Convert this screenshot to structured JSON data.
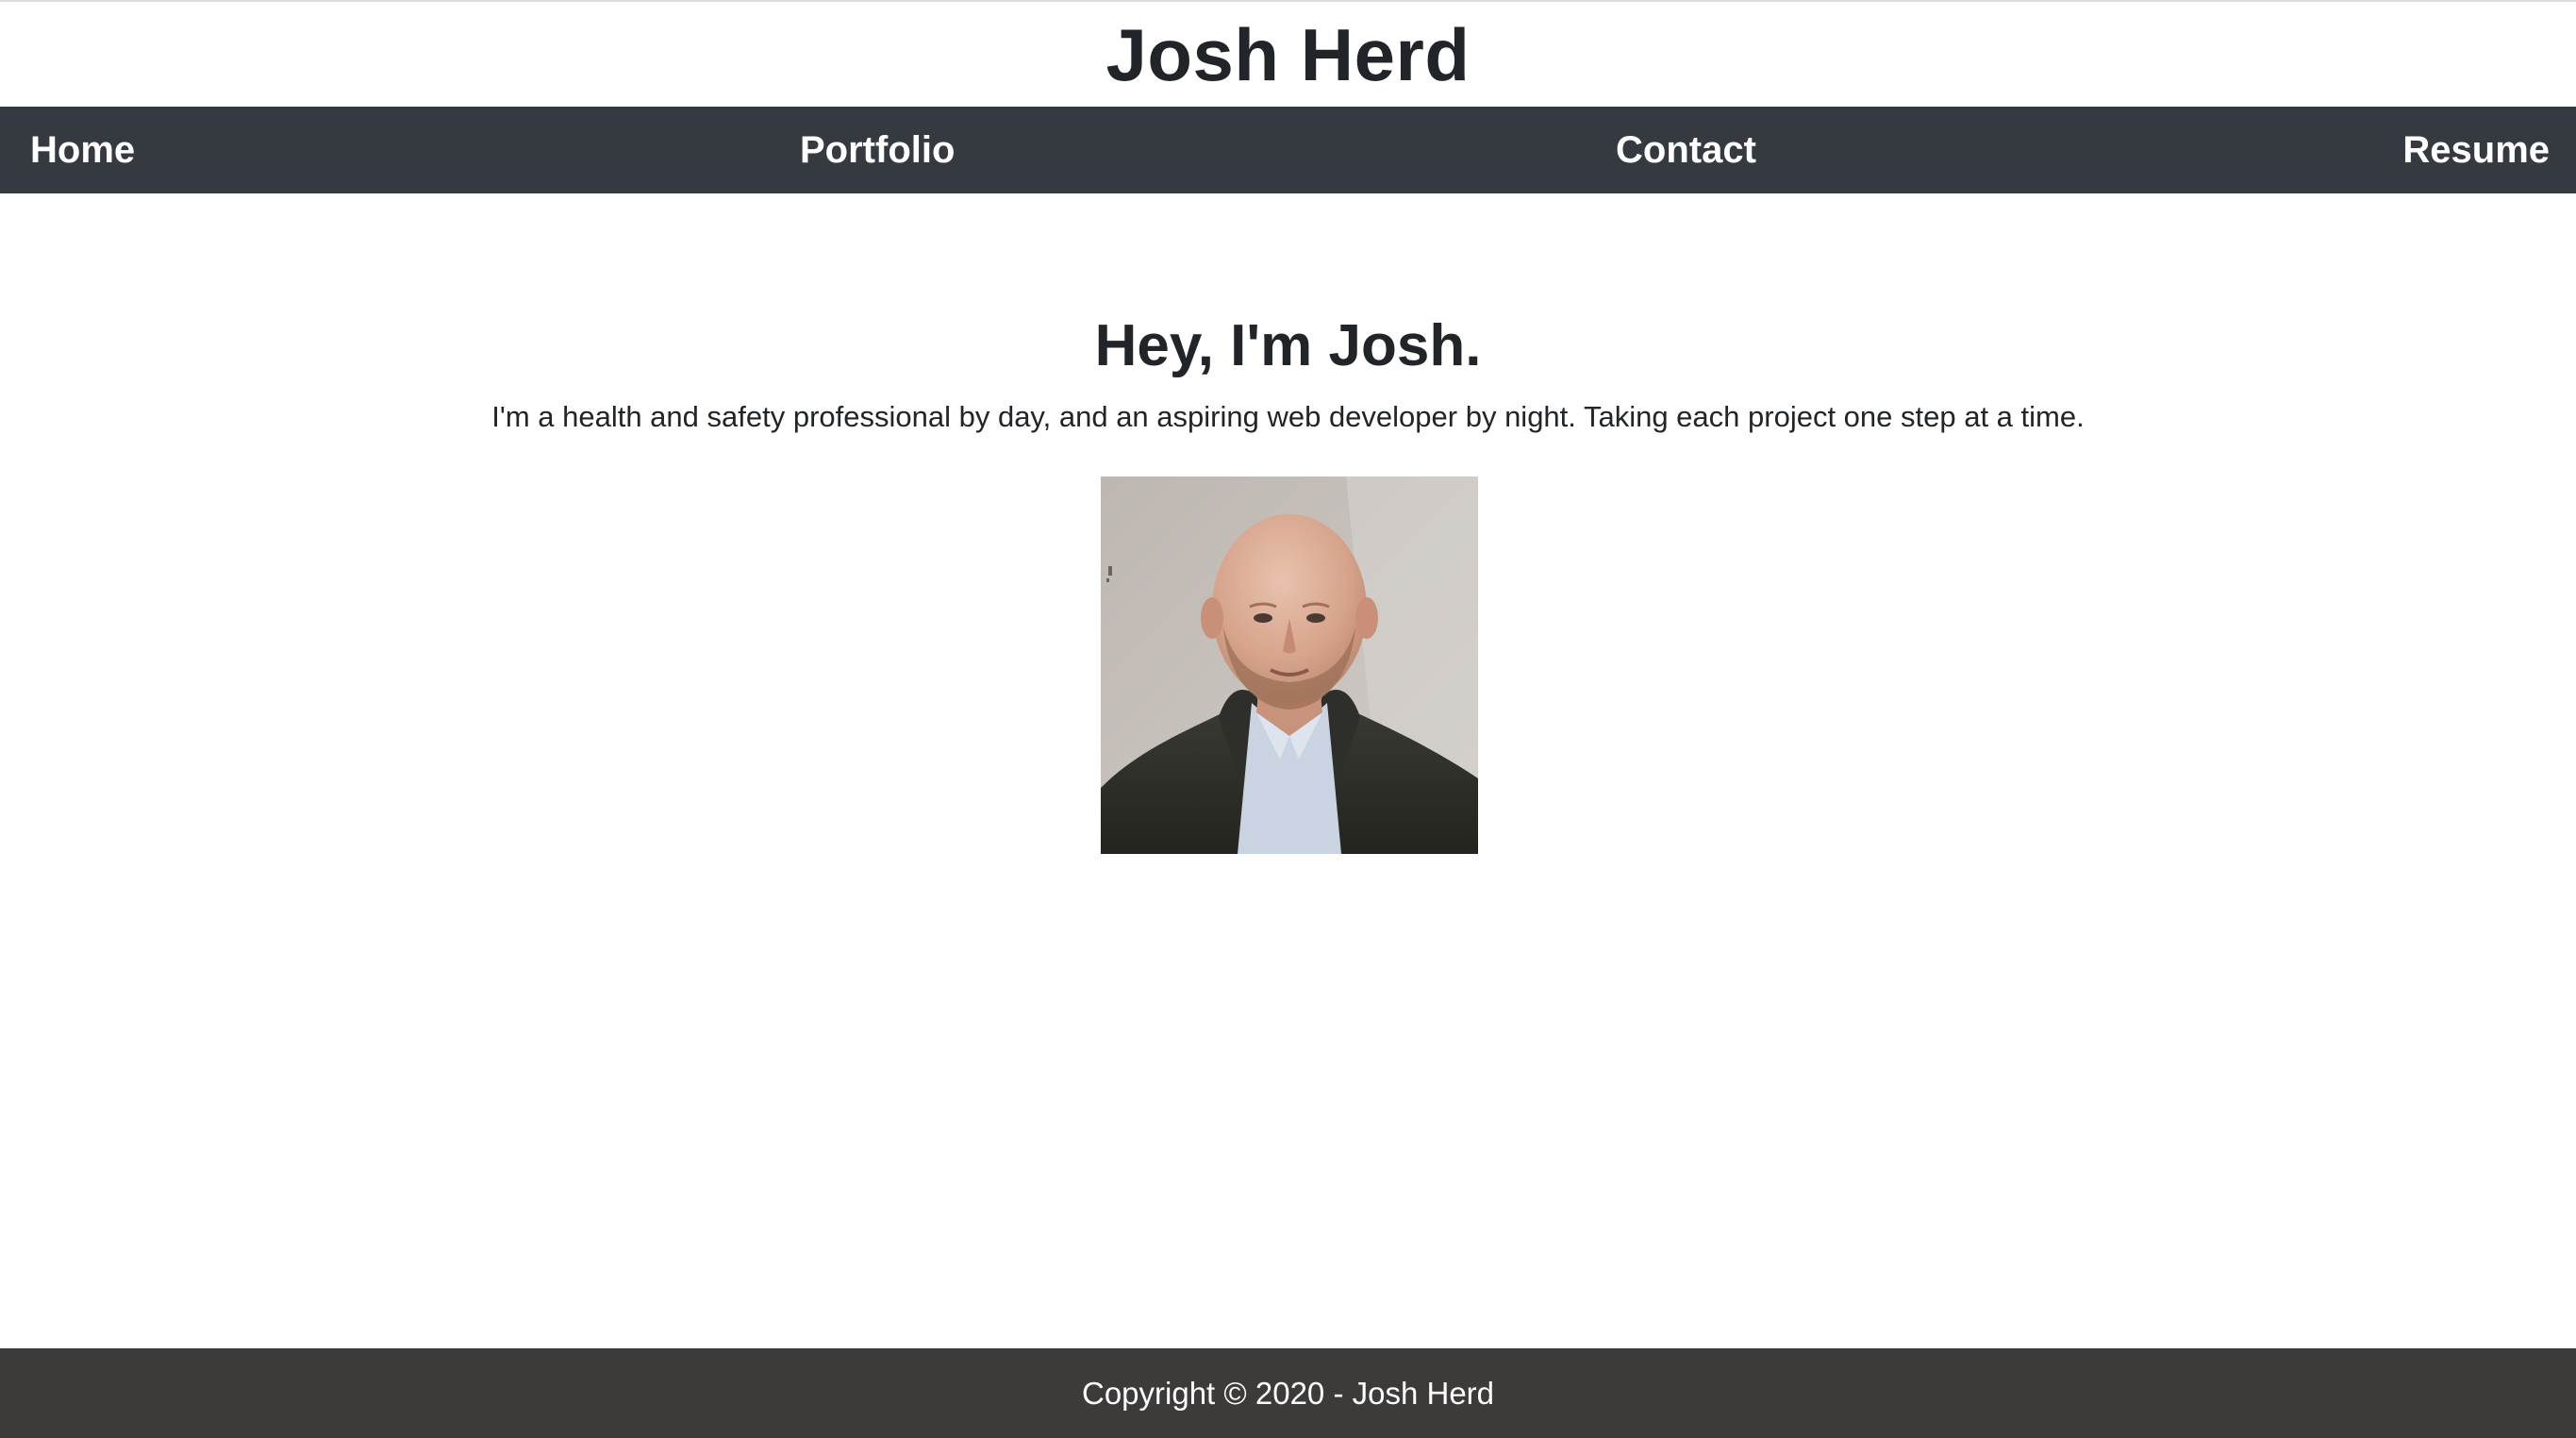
{
  "header": {
    "title": "Josh Herd"
  },
  "nav": {
    "items": [
      {
        "label": "Home"
      },
      {
        "label": "Portfolio"
      },
      {
        "label": "Contact"
      },
      {
        "label": "Resume"
      }
    ],
    "background_color": "#343a40"
  },
  "hero": {
    "heading": "Hey, I'm Josh.",
    "text": "I'm a health and safety professional by day, and an aspiring web developer by night. Taking each project one step at a time.",
    "photo_icon": "profile-photo"
  },
  "footer": {
    "text": "Copyright © 2020 - Josh Herd",
    "background_color": "#3d3a3a"
  }
}
